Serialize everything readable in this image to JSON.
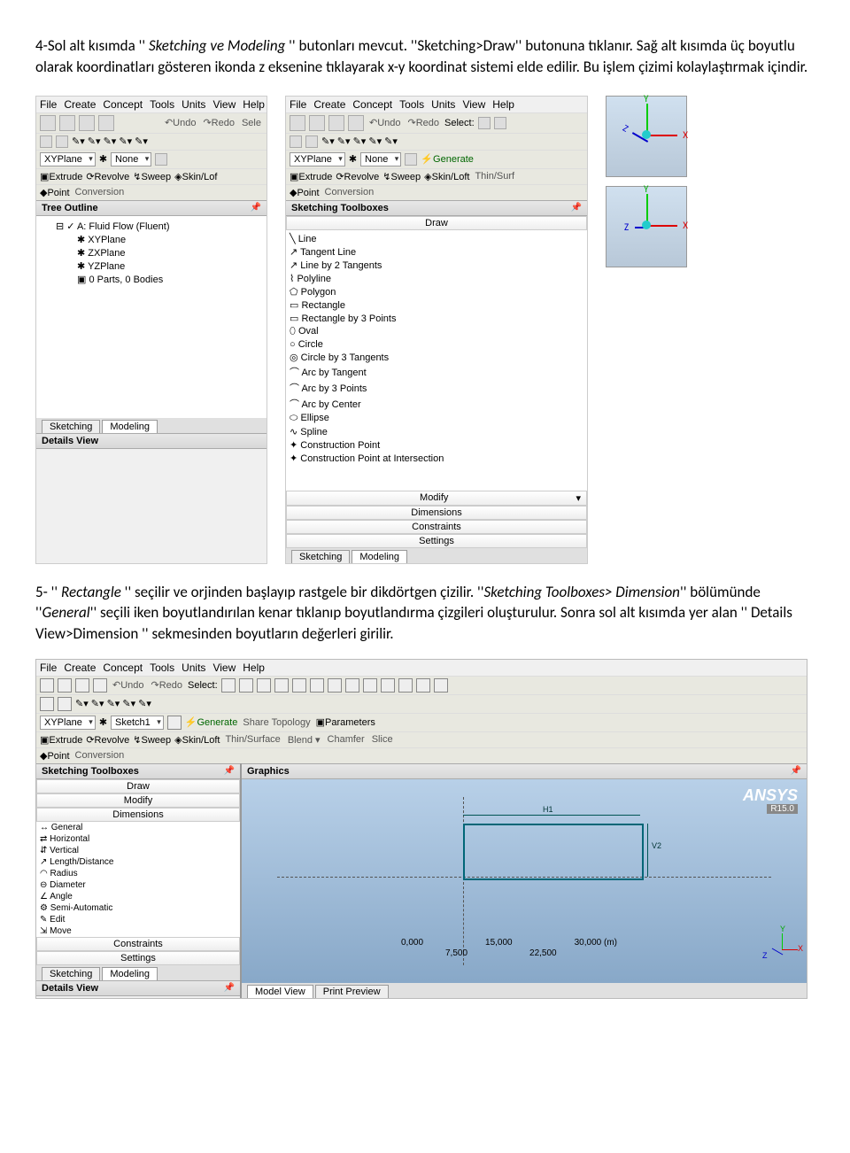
{
  "para1": {
    "t1": "4-Sol alt kısımda '' ",
    "i1": "Sketching ve Modeling",
    "t2": " '' butonları mevcut. ''Sketching>Draw'' butonuna tıklanır. Sağ alt kısımda üç boyutlu olarak koordinatları gösteren ikonda z eksenine tıklayarak x-y koordinat sistemi elde edilir. Bu işlem çizimi kolaylaştırmak içindir."
  },
  "para2": {
    "t1": "5- '' ",
    "i1": "Rectangle",
    "t2": " '' seçilir ve orjinden başlayıp rastgele bir dikdörtgen çizilir. ''",
    "i2": "Sketching Toolboxes> Dimension",
    "t3": "'' bölümünde ''",
    "i3": "General",
    "t4": "'' seçili iken boyutlandırılan kenar tıklanıp  boyutlandırma çizgileri oluşturulur. Sonra sol alt kısımda yer alan '' Details View>Dimension '' sekmesinden boyutların değerleri girilir."
  },
  "menu": {
    "file": "File",
    "create": "Create",
    "concept": "Concept",
    "tools": "Tools",
    "units": "Units",
    "view": "View",
    "help": "Help"
  },
  "toolbar": {
    "undo": "Undo",
    "redo": "Redo",
    "select": "Select:",
    "sele": "Sele",
    "generate": "Generate",
    "sharetopo": "Share Topology",
    "parameters": "Parameters"
  },
  "row1": {
    "xyplane": "XYPlane",
    "none": "None",
    "sketch1": "Sketch1"
  },
  "row2": {
    "extrude": "Extrude",
    "revolve": "Revolve",
    "sweep": "Sweep",
    "skinloft": "Skin/Loft",
    "skinlof": "Skin/Lof",
    "thinsurf": "Thin/Surf",
    "thinsurface": "Thin/Surface",
    "blend": "Blend",
    "chamfer": "Chamfer",
    "slice": "Slice"
  },
  "row3": {
    "point": "Point",
    "conversion": "Conversion"
  },
  "treeoutline": "Tree Outline",
  "tree": {
    "root": "A: Fluid Flow (Fluent)",
    "xy": "XYPlane",
    "zx": "ZXPlane",
    "yz": "YZPlane",
    "parts": "0 Parts, 0 Bodies"
  },
  "sketchtb": "Sketching Toolboxes",
  "drawhead": "Draw",
  "draw": [
    "Line",
    "Tangent Line",
    "Line by 2 Tangents",
    "Polyline",
    "Polygon",
    "Rectangle",
    "Rectangle by 3 Points",
    "Oval",
    "Circle",
    "Circle by 3 Tangents",
    "Arc by Tangent",
    "Arc by 3 Points",
    "Arc by Center",
    "Ellipse",
    "Spline",
    "Construction Point",
    "Construction Point at Intersection"
  ],
  "cats": {
    "modify": "Modify",
    "dimensions": "Dimensions",
    "constraints": "Constraints",
    "settings": "Settings"
  },
  "tabs": {
    "sketching": "Sketching",
    "modeling": "Modeling",
    "modelview": "Model View",
    "printpreview": "Print Preview"
  },
  "detailsview": "Details View",
  "graphics": "Graphics",
  "ansys": "ANSYS",
  "ansysv": "R15.0",
  "dims": {
    "general": "General",
    "horizontal": "Horizontal",
    "vertical": "Vertical",
    "lengthdist": "Length/Distance",
    "radius": "Radius",
    "diameter": "Diameter",
    "angle": "Angle",
    "semiauto": "Semi-Automatic",
    "edit": "Edit",
    "move": "Move"
  },
  "dimlabel": {
    "h1": "H1",
    "v2": "V2"
  },
  "ruler": {
    "r0": "0,000",
    "r15": "15,000",
    "r30": "30,000 (m)",
    "r7": "7,500",
    "r22": "22,500"
  }
}
